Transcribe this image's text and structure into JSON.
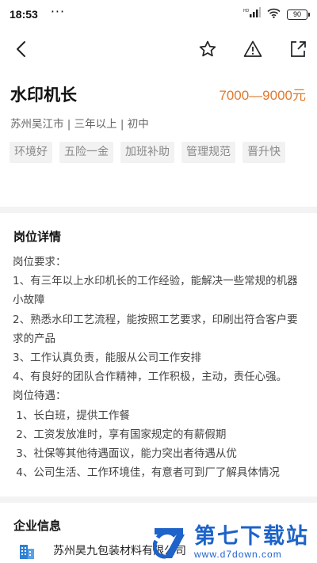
{
  "status_bar": {
    "time": "18:53",
    "dots": "···",
    "signal_label": "HD",
    "battery": "90"
  },
  "nav": {
    "back": "back-icon",
    "favorite": "star-icon",
    "report": "warning-icon",
    "share": "share-icon"
  },
  "job": {
    "title": "水印机长",
    "salary": "7000—9000元",
    "meta": "苏州吴江市 | 三年以上 | 初中",
    "tags": [
      "环境好",
      "五险一金",
      "加班补助",
      "管理规范",
      "晋升快"
    ]
  },
  "details": {
    "heading": "岗位详情",
    "lines": [
      "岗位要求：",
      "1、有三年以上水印机长的工作经验，能解决一些常规的机器小故障",
      "2、熟悉水印工艺流程，能按照工艺要求，印刷出符合客户要求的产品",
      "3、工作认真负责，能服从公司工作安排",
      "4、有良好的团队合作精神，工作积极，主动，责任心强。",
      "岗位待遇：",
      " 1、长白班，提供工作餐",
      " 2、工资发放准时，享有国家规定的有薪假期",
      " 3、社保等其他待遇面议，能力突出者待遇从优",
      " 4、公司生活、工作环境佳，有意者可到厂了解具体情况"
    ]
  },
  "company": {
    "heading": "企业信息",
    "name": "苏州昊九包装材料有限公司"
  },
  "watermark": {
    "title": "第七下载站",
    "url": "www.d7down.com"
  },
  "colors": {
    "salary": "#e07a2f",
    "accent_blue": "#1d63c9",
    "tag_bg": "#f2f2f2"
  }
}
